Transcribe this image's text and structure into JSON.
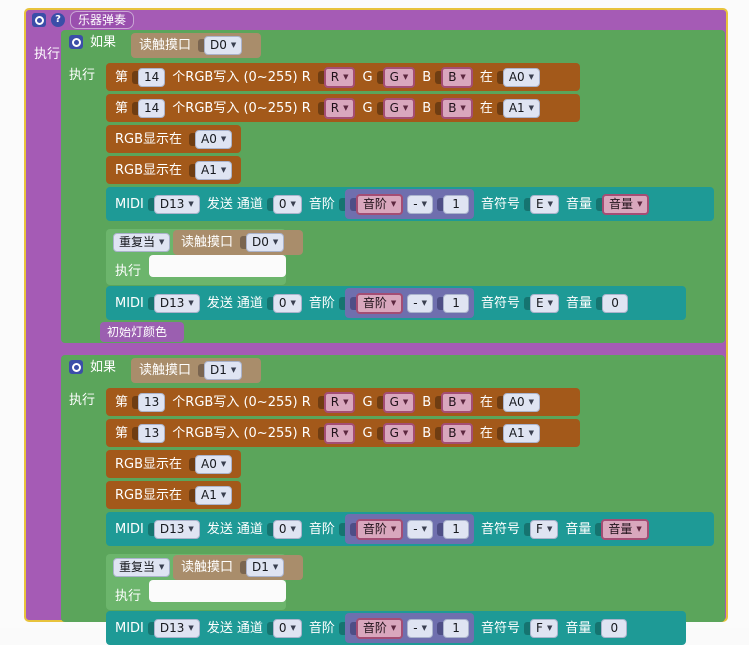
{
  "app": {
    "workspace_background": "#fbfbfb",
    "language": "zh-CN"
  },
  "event_block": {
    "title": "乐器弹奏",
    "gear_icon": "gear-icon",
    "help_icon": "help-icon",
    "do_label": "执行",
    "color": "#a55bb5",
    "border_color": "#e8c33c"
  },
  "labels": {
    "if": "如果",
    "do": "执行",
    "repeat_while": "重复当",
    "read_touch_port": "读触摸口",
    "nth": "第",
    "rgb_write": "个RGB写入 (0~255) R",
    "g": "G",
    "b": "B",
    "at": "在",
    "rgb_show_at": "RGB显示在",
    "midi": "MIDI",
    "send": "发送",
    "channel": "通道",
    "scale": "音阶",
    "note": "音符号",
    "volume": "音量",
    "init_light_color": "初始灯颜色",
    "minus": "-"
  },
  "sections": [
    {
      "name": "section-d0",
      "if_condition_port": "D0",
      "rgb_index": "14",
      "rgb_r": "R",
      "rgb_g": "G",
      "rgb_b": "B",
      "rgb_pin_1": "A0",
      "rgb_pin_2": "A1",
      "show_pin_1": "A0",
      "show_pin_2": "A1",
      "midi_on": {
        "pin": "D13",
        "channel": "0",
        "scale_var": "音阶",
        "operator": "-",
        "operand": "1",
        "note": "E",
        "volume": "音量",
        "volume_is_variable": true
      },
      "while_condition_port": "D0",
      "midi_off": {
        "pin": "D13",
        "channel": "0",
        "scale_var": "音阶",
        "operator": "-",
        "operand": "1",
        "note": "E",
        "volume": "0",
        "volume_is_variable": false
      },
      "procedure_call": "初始灯颜色"
    },
    {
      "name": "section-d1",
      "if_condition_port": "D1",
      "rgb_index": "13",
      "rgb_r": "R",
      "rgb_g": "G",
      "rgb_b": "B",
      "rgb_pin_1": "A0",
      "rgb_pin_2": "A1",
      "show_pin_1": "A0",
      "show_pin_2": "A1",
      "midi_on": {
        "pin": "D13",
        "channel": "0",
        "scale_var": "音阶",
        "operator": "-",
        "operand": "1",
        "note": "F",
        "volume": "音量",
        "volume_is_variable": true
      },
      "while_condition_port": "D1",
      "midi_off": {
        "pin": "D13",
        "channel": "0",
        "scale_var": "音阶",
        "operator": "-",
        "operand": "1",
        "note": "F",
        "volume": "0",
        "volume_is_variable": false
      }
    }
  ],
  "colors": {
    "event": "#a55bb5",
    "control": "#5ba55b",
    "loop": "#6cb56c",
    "neopixel": "#a3591a",
    "midi": "#1e9a96",
    "sensor": "#a98d6b",
    "procedure": "#9b5fb0",
    "math": "#6f6fae",
    "variable": "#d9a7bd",
    "field": "#dfe4f2"
  }
}
